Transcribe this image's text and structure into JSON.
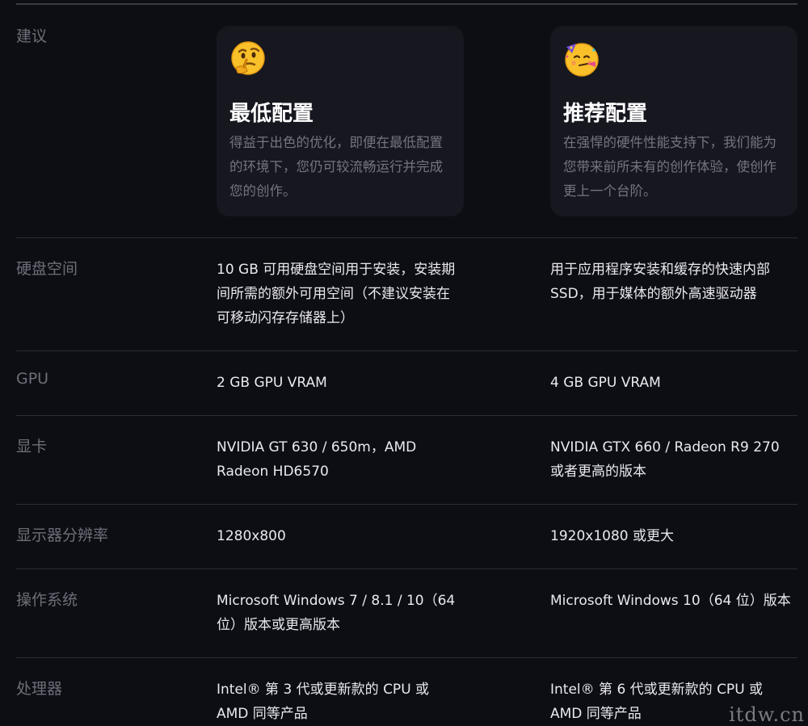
{
  "labels": {
    "suggest": "建议",
    "disk": "硬盘空间",
    "gpu": "GPU",
    "graphics": "显卡",
    "resolution": "显示器分辨率",
    "os": "操作系统",
    "cpu": "处理器"
  },
  "cards": {
    "min": {
      "emoji": "thinking-face-icon",
      "title": "最低配置",
      "desc": "得益于出色的优化，即便在最低配置的环境下，您仍可较流畅运行并完成您的创作。"
    },
    "rec": {
      "emoji": "party-face-icon",
      "title": "推荐配置",
      "desc": "在强悍的硬件性能支持下，我们能为您带来前所未有的创作体验，使创作更上一个台阶。"
    }
  },
  "min": {
    "disk": "10 GB 可用硬盘空间用于安装，安装期间所需的额外可用空间（不建议安装在可移动闪存存储器上）",
    "gpu": "2 GB GPU VRAM",
    "graphics": "NVIDIA GT 630 / 650m，AMD Radeon HD6570",
    "resolution": "1280x800",
    "os": "Microsoft Windows 7 / 8.1 / 10（64 位）版本或更高版本",
    "cpu": "Intel® 第 3 代或更新款的 CPU 或 AMD 同等产品"
  },
  "rec": {
    "disk": "用于应用程序安装和缓存的快速内部 SSD，用于媒体的额外高速驱动器",
    "gpu": "4 GB GPU VRAM",
    "graphics": "NVIDIA GTX 660 / Radeon R9 270 或者更高的版本",
    "resolution": "1920x1080 或更大",
    "os": "Microsoft Windows 10（64 位）版本",
    "cpu": "Intel® 第 6 代或更新款的 CPU 或 AMD 同等产品"
  },
  "watermark": "itdw.cn"
}
